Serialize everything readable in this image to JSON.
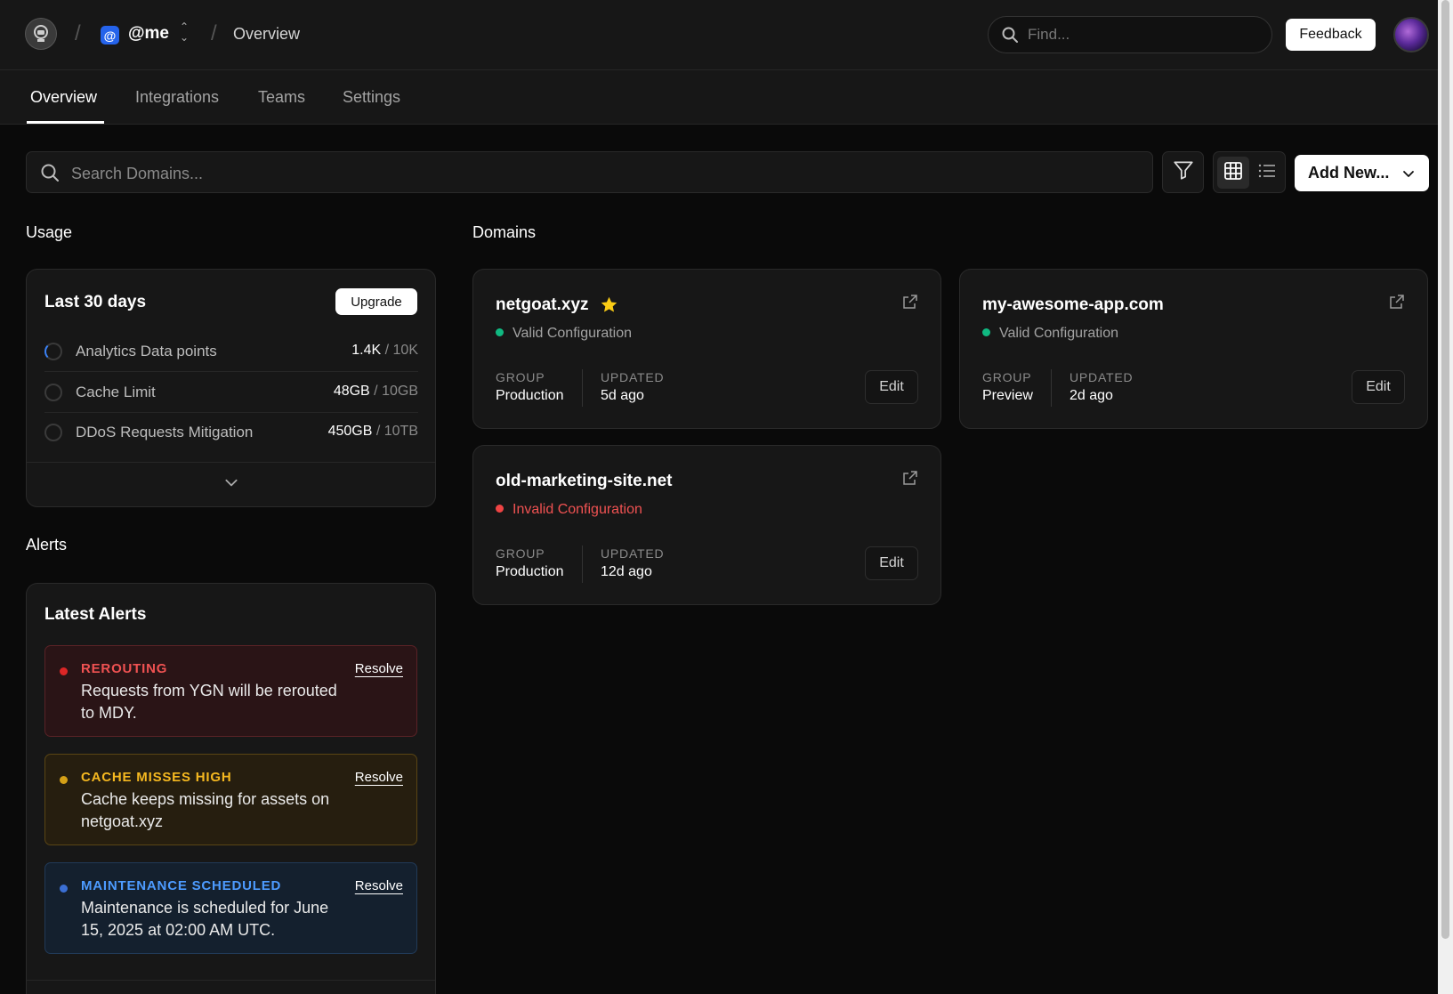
{
  "header": {
    "scope_icon": "@",
    "scope_name": "@me",
    "breadcrumb_page": "Overview",
    "find_placeholder": "Find...",
    "feedback_label": "Feedback"
  },
  "tabs": [
    {
      "label": "Overview",
      "active": true
    },
    {
      "label": "Integrations",
      "active": false
    },
    {
      "label": "Teams",
      "active": false
    },
    {
      "label": "Settings",
      "active": false
    }
  ],
  "toolbar": {
    "search_placeholder": "Search Domains...",
    "add_new_label": "Add New..."
  },
  "usage": {
    "section_title": "Usage",
    "card_title": "Last 30 days",
    "upgrade_label": "Upgrade",
    "rows": [
      {
        "label": "Analytics Data points",
        "used": "1.4K",
        "limit": "10K"
      },
      {
        "label": "Cache Limit",
        "used": "48GB",
        "limit": "10GB"
      },
      {
        "label": "DDoS Requests Mitigation",
        "used": "450GB",
        "limit": "10TB"
      }
    ]
  },
  "alerts": {
    "section_title": "Alerts",
    "card_title": "Latest Alerts",
    "resolve_label": "Resolve",
    "items": [
      {
        "title": "REROUTING",
        "message": "Requests from YGN will be rerouted to MDY.",
        "color": "#f05252"
      },
      {
        "title": "CACHE MISSES HIGH",
        "message": "Cache keeps missing for assets on netgoat.xyz",
        "color": "#f5b820"
      },
      {
        "title": "MAINTENANCE SCHEDULED",
        "message": "Maintenance is scheduled for June 15, 2025 at 02:00 AM UTC.",
        "color": "#4d9bff"
      }
    ]
  },
  "domains": {
    "section_title": "Domains",
    "group_label": "GROUP",
    "updated_label": "UPDATED",
    "edit_label": "Edit",
    "items": [
      {
        "name": "netgoat.xyz",
        "starred": true,
        "status": "Valid Configuration",
        "group": "Production",
        "updated": "5d ago"
      },
      {
        "name": "my-awesome-app.com",
        "starred": false,
        "status": "Valid Configuration",
        "group": "Preview",
        "updated": "2d ago"
      },
      {
        "name": "old-marketing-site.net",
        "starred": false,
        "status": "Invalid Configuration",
        "group": "Production",
        "updated": "12d ago"
      }
    ]
  },
  "colors": {
    "valid": "#10b981",
    "invalid": "#ef4444",
    "star": "#facc15",
    "accent": "#2563eb"
  }
}
